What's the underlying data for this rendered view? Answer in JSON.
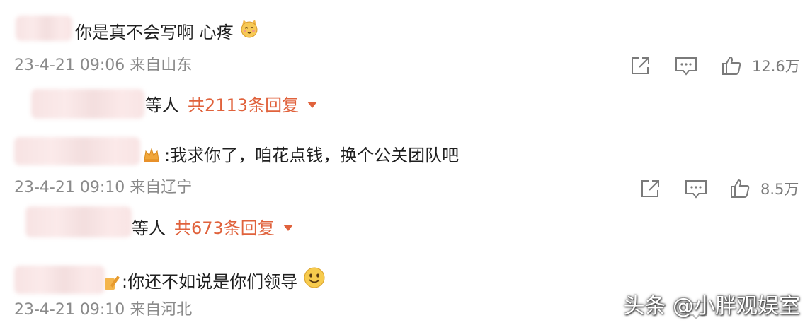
{
  "comments": [
    {
      "text": "你是真不会写啊 心疼",
      "emoji": "cat-face-icon",
      "meta": "23-4-21 09:06 来自山东",
      "likes": "12.6万",
      "reply_suffix": "等人",
      "reply_count": "共2113条回复"
    },
    {
      "text": ":我求你了，咱花点钱，换个公关团队吧",
      "emoji": "crown-badge-icon",
      "meta": "23-4-21 09:10 来自辽宁",
      "likes": "8.5万",
      "reply_suffix": "等人",
      "reply_count": "共673条回复"
    },
    {
      "text": ":你还不如说是你们领导",
      "emoji": "smile-face-icon",
      "meta": "23-4-21 09:10 来自河北",
      "likes": "",
      "reply_suffix": "",
      "reply_count": ""
    }
  ],
  "watermark": "头条 @小胖观娱室",
  "colors": {
    "accent": "#e0623c",
    "meta": "#8a8a8a",
    "icon": "#7a7a7a"
  }
}
